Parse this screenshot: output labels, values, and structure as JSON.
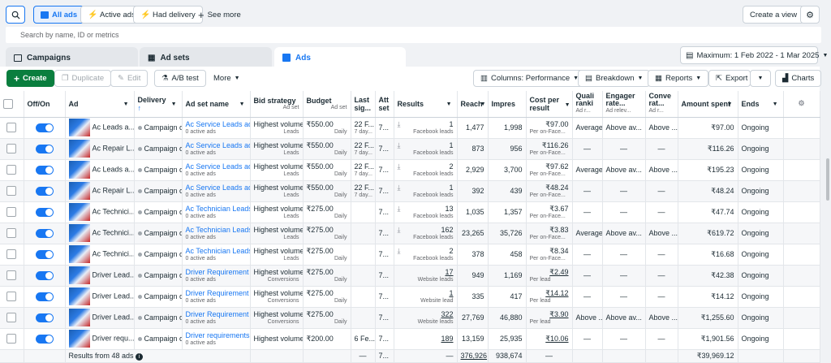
{
  "filters": {
    "all_ads": "All ads",
    "active_ads": "Active ads",
    "had_delivery": "Had delivery",
    "see_more": "See more",
    "create_view": "Create a view"
  },
  "search": {
    "placeholder": "Search by name, ID or metrics"
  },
  "tabs": {
    "campaigns": "Campaigns",
    "ad_sets": "Ad sets",
    "ads": "Ads"
  },
  "date_range": "Maximum: 1 Feb 2022 - 1 Mar 2025",
  "toolbar": {
    "create": "Create",
    "duplicate": "Duplicate",
    "edit": "Edit",
    "ab_test": "A/B test",
    "more": "More",
    "columns": "Columns: Performance",
    "breakdown": "Breakdown",
    "reports": "Reports",
    "export": "Export",
    "charts": "Charts"
  },
  "columns": {
    "offon": "Off/On",
    "ad": "Ad",
    "delivery": "Delivery",
    "adset": "Ad set name",
    "bid": "Bid strategy",
    "bid_sub": "Ad set",
    "budget": "Budget",
    "budget_sub": "Ad set",
    "last": "Last sig...",
    "att": "Att set",
    "results": "Results",
    "reach": "Reach",
    "impr": "Impres",
    "cpr": "Cost per result",
    "quality": "Quali ranki",
    "quality_sub": "Ad r...",
    "engager": "Engager rate...",
    "engager_sub": "Ad relev...",
    "conv": "Conve rat...",
    "conv_sub": "Ad r...",
    "amount": "Amount spent",
    "ends": "Ends"
  },
  "rows": [
    {
      "ad": "Ac Leads a...",
      "delivery": "Campaign of",
      "adset": "Ac Service Leads ad...",
      "bid": "Highest volume",
      "bid_sub": "Leads",
      "budget": "₹550.00",
      "budget_sub": "Daily",
      "last": "22 F...",
      "last_sub": "7 day...",
      "att": "7...",
      "results": "1",
      "results_sub": "Facebook leads",
      "reach": "1,477",
      "impr": "1,998",
      "cpr": "₹97.00",
      "cpr_sub": "Per on-Face...",
      "quality": "Average",
      "engager": "Above av...",
      "conv": "Above ...",
      "amount": "₹97.00",
      "ends": "Ongoing"
    },
    {
      "ad": "Ac Repair L...",
      "delivery": "Campaign of",
      "adset": "Ac Service Leads ad...",
      "bid": "Highest volume",
      "bid_sub": "Leads",
      "budget": "₹550.00",
      "budget_sub": "Daily",
      "last": "22 F...",
      "last_sub": "7 day...",
      "att": "7...",
      "results": "1",
      "results_sub": "Facebook leads",
      "reach": "873",
      "impr": "956",
      "cpr": "₹116.26",
      "cpr_sub": "Per on-Face...",
      "quality": "—",
      "engager": "—",
      "conv": "—",
      "amount": "₹116.26",
      "ends": "Ongoing"
    },
    {
      "ad": "Ac Leads a...",
      "delivery": "Campaign of",
      "adset": "Ac Service Leads ad...",
      "bid": "Highest volume",
      "bid_sub": "Leads",
      "budget": "₹550.00",
      "budget_sub": "Daily",
      "last": "22 F...",
      "last_sub": "7 day...",
      "att": "7...",
      "results": "2",
      "results_sub": "Facebook leads",
      "reach": "2,929",
      "impr": "3,700",
      "cpr": "₹97.62",
      "cpr_sub": "Per on-Face...",
      "quality": "Average",
      "engager": "Above av...",
      "conv": "Above ...",
      "amount": "₹195.23",
      "ends": "Ongoing"
    },
    {
      "ad": "Ac Repair L...",
      "delivery": "Campaign of",
      "adset": "Ac Service Leads ad...",
      "bid": "Highest volume",
      "bid_sub": "Leads",
      "budget": "₹550.00",
      "budget_sub": "Daily",
      "last": "22 F...",
      "last_sub": "7 day...",
      "att": "7...",
      "results": "1",
      "results_sub": "Facebook leads",
      "reach": "392",
      "impr": "439",
      "cpr": "₹48.24",
      "cpr_sub": "Per on-Face...",
      "quality": "—",
      "engager": "—",
      "conv": "—",
      "amount": "₹48.24",
      "ends": "Ongoing"
    },
    {
      "ad": "Ac Technici...",
      "delivery": "Campaign of",
      "adset": "Ac Technician Leads...",
      "bid": "Highest volume",
      "bid_sub": "Leads",
      "budget": "₹275.00",
      "budget_sub": "Daily",
      "last": "",
      "last_sub": "",
      "att": "7...",
      "results": "13",
      "results_sub": "Facebook leads",
      "reach": "1,035",
      "impr": "1,357",
      "cpr": "₹3.67",
      "cpr_sub": "Per on-Face...",
      "quality": "—",
      "engager": "—",
      "conv": "—",
      "amount": "₹47.74",
      "ends": "Ongoing"
    },
    {
      "ad": "Ac Technici...",
      "delivery": "Campaign of",
      "adset": "Ac Technician Leads...",
      "bid": "Highest volume",
      "bid_sub": "Leads",
      "budget": "₹275.00",
      "budget_sub": "Daily",
      "last": "",
      "last_sub": "",
      "att": "7...",
      "results": "162",
      "results_sub": "Facebook leads",
      "reach": "23,265",
      "impr": "35,726",
      "cpr": "₹3.83",
      "cpr_sub": "Per on-Face...",
      "quality": "Average",
      "engager": "Above av...",
      "conv": "Above ...",
      "amount": "₹619.72",
      "ends": "Ongoing"
    },
    {
      "ad": "Ac Technici...",
      "delivery": "Campaign of",
      "adset": "Ac Technician Leads...",
      "bid": "Highest volume",
      "bid_sub": "Leads",
      "budget": "₹275.00",
      "budget_sub": "Daily",
      "last": "",
      "last_sub": "",
      "att": "7...",
      "results": "2",
      "results_sub": "Facebook leads",
      "reach": "378",
      "impr": "458",
      "cpr": "₹8.34",
      "cpr_sub": "Per on-Face...",
      "quality": "—",
      "engager": "—",
      "conv": "—",
      "amount": "₹16.68",
      "ends": "Ongoing"
    },
    {
      "ad": "Driver Lead...",
      "delivery": "Campaign of",
      "adset": "Driver Requirement ...",
      "bid": "Highest volume",
      "bid_sub": "Conversions",
      "budget": "₹275.00",
      "budget_sub": "Daily",
      "last": "",
      "last_sub": "",
      "att": "7...",
      "results": "17",
      "results_sub": "Website leads",
      "reach": "949",
      "impr": "1,169",
      "cpr": "₹2.49",
      "cpr_sub": "Per lead",
      "quality": "—",
      "engager": "—",
      "conv": "—",
      "amount": "₹42.38",
      "ends": "Ongoing"
    },
    {
      "ad": "Driver Lead...",
      "delivery": "Campaign of",
      "adset": "Driver Requirement ...",
      "bid": "Highest volume",
      "bid_sub": "Conversions",
      "budget": "₹275.00",
      "budget_sub": "Daily",
      "last": "",
      "last_sub": "",
      "att": "7...",
      "results": "1",
      "results_sub": "Website lead",
      "reach": "335",
      "impr": "417",
      "cpr": "₹14.12",
      "cpr_sub": "Per lead",
      "quality": "—",
      "engager": "—",
      "conv": "—",
      "amount": "₹14.12",
      "ends": "Ongoing"
    },
    {
      "ad": "Driver Lead...",
      "delivery": "Campaign of",
      "adset": "Driver Requirement ...",
      "bid": "Highest volume",
      "bid_sub": "Conversions",
      "budget": "₹275.00",
      "budget_sub": "Daily",
      "last": "",
      "last_sub": "",
      "att": "7...",
      "results": "322",
      "results_sub": "Website leads",
      "reach": "27,769",
      "impr": "46,880",
      "cpr": "₹3.90",
      "cpr_sub": "Per lead",
      "quality": "Above ...",
      "engager": "Above av...",
      "conv": "Above ...",
      "amount": "₹1,255.60",
      "ends": "Ongoing"
    },
    {
      "ad": "Driver requ...",
      "delivery": "Campaign of",
      "adset": "Driver requirements...",
      "bid": "Highest volume",
      "bid_sub": "",
      "budget": "₹200.00",
      "budget_sub": "",
      "last": "6 Fe...",
      "last_sub": "",
      "att": "7...",
      "results": "189",
      "results_sub": "",
      "reach": "13,159",
      "impr": "25,935",
      "cpr": "₹10.06",
      "cpr_sub": "",
      "quality": "—",
      "engager": "—",
      "conv": "—",
      "amount": "₹1,901.56",
      "ends": "Ongoing"
    }
  ],
  "footer": {
    "label": "Results from 48 ads",
    "last": "—",
    "att": "7...",
    "results": "—",
    "reach": "376,926",
    "impr": "938,674",
    "cpr": "—",
    "amount": "₹39,969.12"
  }
}
